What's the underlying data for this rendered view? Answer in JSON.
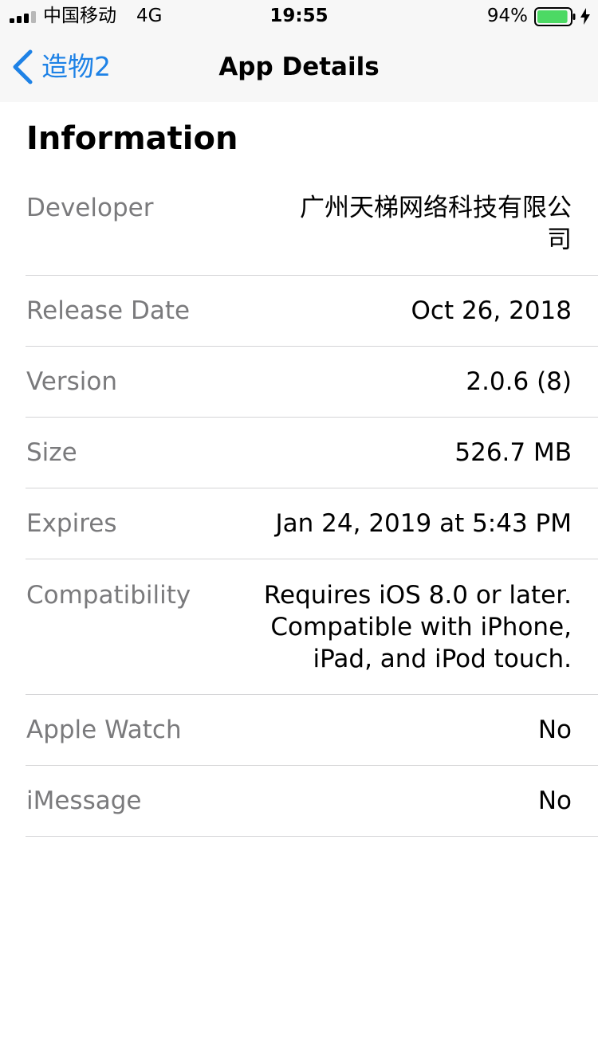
{
  "status_bar": {
    "carrier": "中国移动",
    "network": "4G",
    "time": "19:55",
    "battery_percent": "94%",
    "battery_level": 0.94,
    "icons": [
      "signal-bars-icon",
      "battery-icon",
      "charging-bolt-icon"
    ]
  },
  "nav": {
    "back_label": "造物2",
    "title": "App Details",
    "accent_color": "#1e82e6"
  },
  "section": {
    "title": "Information"
  },
  "info": {
    "developer": {
      "label": "Developer",
      "value": "广州天梯网络科技有限公司"
    },
    "release_date": {
      "label": "Release Date",
      "value": "Oct 26, 2018"
    },
    "version": {
      "label": "Version",
      "value": "2.0.6 (8)"
    },
    "size": {
      "label": "Size",
      "value": "526.7 MB"
    },
    "expires": {
      "label": "Expires",
      "value": "Jan 24, 2019 at 5:43 PM"
    },
    "compatibility": {
      "label": "Compatibility",
      "value": "Requires iOS 8.0 or later. Compatible with iPhone, iPad, and iPod touch."
    },
    "apple_watch": {
      "label": "Apple Watch",
      "value": "No"
    },
    "imessage": {
      "label": "iMessage",
      "value": "No"
    }
  }
}
